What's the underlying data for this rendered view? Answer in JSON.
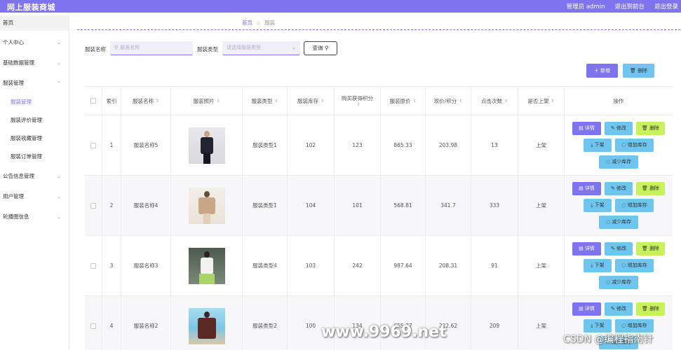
{
  "header": {
    "brand": "网上服装商城",
    "user": "管理员 admin",
    "back_to_front": "退出到前台",
    "logout": "退出登录",
    "bg_color": "#7f74f0"
  },
  "sidebar": {
    "home": "首页",
    "items": [
      {
        "label": "个人中心",
        "chevron": "chevron-down-icon"
      },
      {
        "label": "基础数据管理",
        "chevron": "chevron-down-icon"
      },
      {
        "label": "服装管理",
        "chevron": "chevron-up-icon"
      }
    ],
    "sub_items": [
      "服装管理",
      "服装评价管理",
      "服装收藏管理",
      "服装订单管理"
    ],
    "more_items": [
      {
        "label": "公告信息管理",
        "chevron": "chevron-down-icon"
      },
      {
        "label": "用户管理",
        "chevron": "chevron-down-icon"
      },
      {
        "label": "轮播图信息",
        "chevron": "chevron-down-icon"
      }
    ]
  },
  "breadcrumb": {
    "home": "首页",
    "current": "服装",
    "sep_icon": "fire-icon"
  },
  "search": {
    "name_label": "服装名称",
    "name_placeholder": "服装名称",
    "type_label": "服装类型",
    "type_placeholder": "请选择服装类型",
    "query_label": "查询"
  },
  "actions": {
    "add": "新增",
    "delete": "删除"
  },
  "table": {
    "headers": [
      "索引",
      "服装名称",
      "服装照片",
      "服装类型",
      "服装库存",
      "购买获得积分",
      "服装原价",
      "现价/积分",
      "点击次数",
      "是否上架",
      "操作"
    ],
    "rows": [
      {
        "index": "1",
        "name": "服装名称5",
        "type": "服装类型1",
        "stock": "102",
        "points": "123",
        "orig_price": "865.33",
        "price": "203.98",
        "clicks": "13",
        "status": "上架"
      },
      {
        "index": "2",
        "name": "服装名称4",
        "type": "服装类型1",
        "stock": "104",
        "points": "101",
        "orig_price": "568.81",
        "price": "341.7",
        "clicks": "333",
        "status": "上架"
      },
      {
        "index": "3",
        "name": "服装名称3",
        "type": "服装类型4",
        "stock": "103",
        "points": "242",
        "orig_price": "987.64",
        "price": "208.31",
        "clicks": "91",
        "status": "上架"
      },
      {
        "index": "4",
        "name": "服装名称2",
        "type": "服装类型2",
        "stock": "100",
        "points": "134",
        "orig_price": "655.37",
        "price": "222.62",
        "clicks": "209",
        "status": "上架"
      }
    ],
    "ops": {
      "detail": "详情",
      "edit": "修改",
      "delete": "删除",
      "off_shelf": "下架",
      "add_stock": "增加库存",
      "reduce_stock": "减少库存"
    }
  },
  "watermark": {
    "main": "www.9969.net",
    "corner": "CSDN @编程指南针"
  }
}
